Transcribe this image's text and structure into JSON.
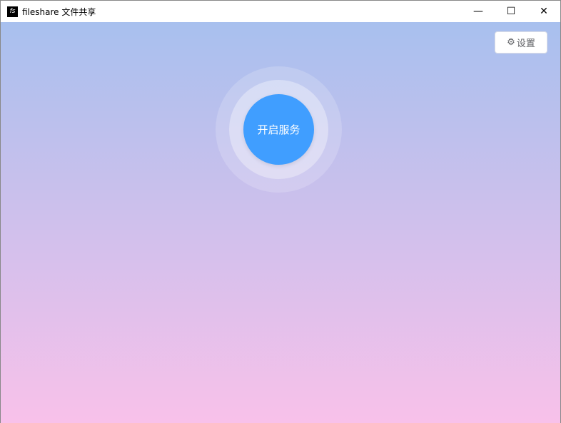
{
  "window": {
    "title": "fileshare 文件共享",
    "icon_text": "fs",
    "minimize": "—",
    "maximize": "☐",
    "close": "✕"
  },
  "toolbar": {
    "settings_label": "设置",
    "settings_icon": "⚙"
  },
  "main": {
    "start_label": "开启服务"
  }
}
